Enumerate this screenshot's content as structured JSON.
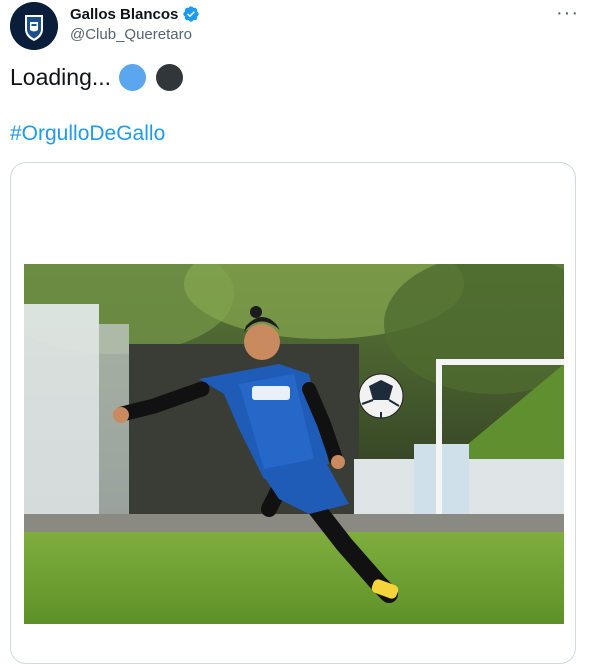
{
  "tweet": {
    "author": {
      "display_name": "Gallos Blancos",
      "handle": "@Club_Queretaro",
      "verified": true,
      "avatar_icon": "club-crest-icon"
    },
    "more_label": "···",
    "text": "Loading...",
    "emoji_icons": [
      "blue-circle-icon",
      "black-circle-icon"
    ],
    "hashtag": "#OrgulloDeGallo",
    "media": {
      "image_icon": "player-kicking-ball-photo"
    }
  },
  "colors": {
    "link": "#1d9bf0",
    "verified": "#1d9bf0",
    "secondary_text": "#536471",
    "card_border": "#cfd9de",
    "jersey": "#1f5cb8"
  }
}
